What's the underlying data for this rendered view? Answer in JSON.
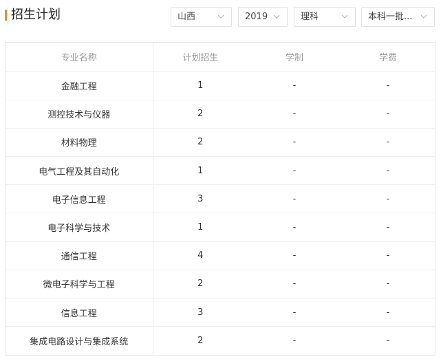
{
  "header": {
    "title": "招生计划"
  },
  "filters": {
    "province": "山西",
    "year": "2019",
    "category": "理科",
    "batch": "本科一批..."
  },
  "table": {
    "columns": [
      "专业名称",
      "计划招生",
      "学制",
      "学费"
    ],
    "rows": [
      [
        "金融工程",
        "1",
        "-",
        "-"
      ],
      [
        "测控技术与仪器",
        "2",
        "-",
        "-"
      ],
      [
        "材料物理",
        "2",
        "-",
        "-"
      ],
      [
        "电气工程及其自动化",
        "1",
        "-",
        "-"
      ],
      [
        "电子信息工程",
        "3",
        "-",
        "-"
      ],
      [
        "电子科学与技术",
        "1",
        "-",
        "-"
      ],
      [
        "通信工程",
        "4",
        "-",
        "-"
      ],
      [
        "微电子科学与工程",
        "2",
        "-",
        "-"
      ],
      [
        "信息工程",
        "3",
        "-",
        "-"
      ],
      [
        "集成电路设计与集成系统",
        "2",
        "-",
        "-"
      ]
    ]
  },
  "icons": {
    "dropdown": "chevron-down-icon"
  },
  "colors": {
    "accent": "#f08a24"
  }
}
